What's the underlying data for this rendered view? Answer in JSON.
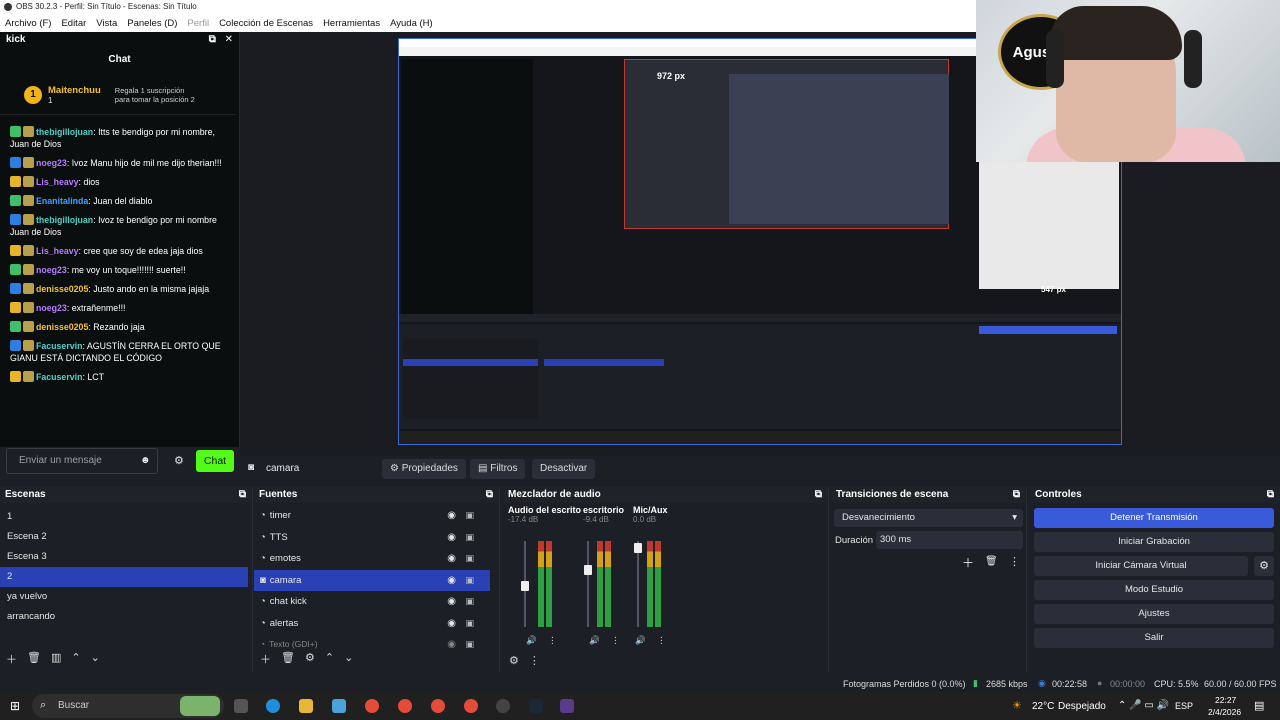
{
  "window_title": "OBS 30.2.3 - Perfil: Sin Título - Escenas: Sin Título",
  "menu": [
    "Archivo (F)",
    "Editar",
    "Vista",
    "Paneles (D)",
    "Perfil",
    "Colección de Escenas",
    "Herramientas",
    "Ayuda (H)"
  ],
  "kick": {
    "dock_title": "kick",
    "chat_title": "Chat",
    "pinned_name": "Maitenchuu",
    "pinned_count": "1",
    "pinned_text_1": "Regala 1 suscripción",
    "pinned_text_2": "para tomar la posición 2",
    "messages": [
      {
        "user": "thebigillojuan",
        "text": "Itts te bendigo por mi nombre, Juan de Dios",
        "color": "#4fd1c5"
      },
      {
        "user": "noeg23",
        "text": "Ivoz Manu hijo de mil me dijo therian!!!",
        "color": "#b57bff"
      },
      {
        "user": "Lis_heavy",
        "text": "dios",
        "color": "#b57bff"
      },
      {
        "user": "Enanitalinda",
        "text": "Juan del diablo",
        "color": "#3fa2ff"
      },
      {
        "user": "thebigillojuan",
        "text": "Ivoz te bendigo por mi nombre Juan de Dios",
        "color": "#4fd1c5"
      },
      {
        "user": "Lis_heavy",
        "text": "cree que soy de edea jaja dios",
        "color": "#b57bff"
      },
      {
        "user": "noeg23",
        "text": "me voy un toque!!!!!!! suerte!!",
        "color": "#b57bff"
      },
      {
        "user": "denisse0205",
        "text": "Justo ando en la misma jajaja",
        "color": "#f2c230"
      },
      {
        "user": "noeg23",
        "text": "extrañenme!!!",
        "color": "#b57bff"
      },
      {
        "user": "denisse0205",
        "text": "Rezando jaja",
        "color": "#f2c230"
      },
      {
        "user": "Facuservin",
        "text": "AGUSTÍN CERRA EL ORTO QUE GIANU ESTÁ DICTANDO EL CÓDIGO",
        "color": "#4fd1c5"
      },
      {
        "user": "Facuservin",
        "text": "LCT",
        "color": "#4fd1c5"
      }
    ],
    "input_placeholder": "Enviar un mensaje",
    "send_label": "Chat"
  },
  "preview": {
    "inner_label_1": "972 px",
    "inner_label_2": "547 px",
    "webcam_logo": "AgussR"
  },
  "source_bar": {
    "source_name": "camara",
    "properties": "Propiedades",
    "filters": "Filtros",
    "deactivate": "Desactivar"
  },
  "scenes": {
    "title": "Escenas",
    "items": [
      "1",
      "Escena 2",
      "Escena 3",
      "2",
      "ya vuelvo",
      "arrancando"
    ],
    "selected_index": 3
  },
  "sources": {
    "title": "Fuentes",
    "items": [
      "timer",
      "TTS",
      "emotes",
      "camara",
      "chat kick",
      "alertas",
      "Texto (GDI+)"
    ],
    "selected_index": 3
  },
  "mixer": {
    "title": "Mezclador de audio",
    "channels": [
      {
        "name": "Audio del escrito",
        "db": "-17.4 dB"
      },
      {
        "name": "escritorio",
        "db": "-9.4 dB"
      },
      {
        "name": "Mic/Aux",
        "db": "0.0 dB"
      }
    ],
    "scale": [
      "0",
      "-5",
      "-10",
      "-15",
      "-20",
      "-25",
      "-30",
      "-35",
      "-40",
      "-45",
      "-50",
      "-55",
      "-60"
    ]
  },
  "transitions": {
    "title": "Transiciones de escena",
    "selected": "Desvanecimiento",
    "duration_label": "Duración",
    "duration_value": "300 ms"
  },
  "controls": {
    "title": "Controles",
    "buttons": [
      "Detener Transmisión",
      "Iniciar Grabación",
      "Iniciar Cámara Virtual",
      "Modo Estudio",
      "Ajustes",
      "Salir"
    ]
  },
  "status": {
    "frames_dropped": "Fotogramas Perdidos 0 (0.0%)",
    "bitrate": "2685 kbps",
    "stream_time": "00:22:58",
    "rec_time": "00:00:00",
    "cpu": "CPU: 5.5%",
    "fps": "60.00 / 60.00 FPS"
  },
  "taskbar": {
    "search_placeholder": "Buscar",
    "weather_temp": "22°C",
    "weather_text": "Despejado",
    "lang": "ESP",
    "time": "22:27",
    "date": "2/4/2026"
  }
}
